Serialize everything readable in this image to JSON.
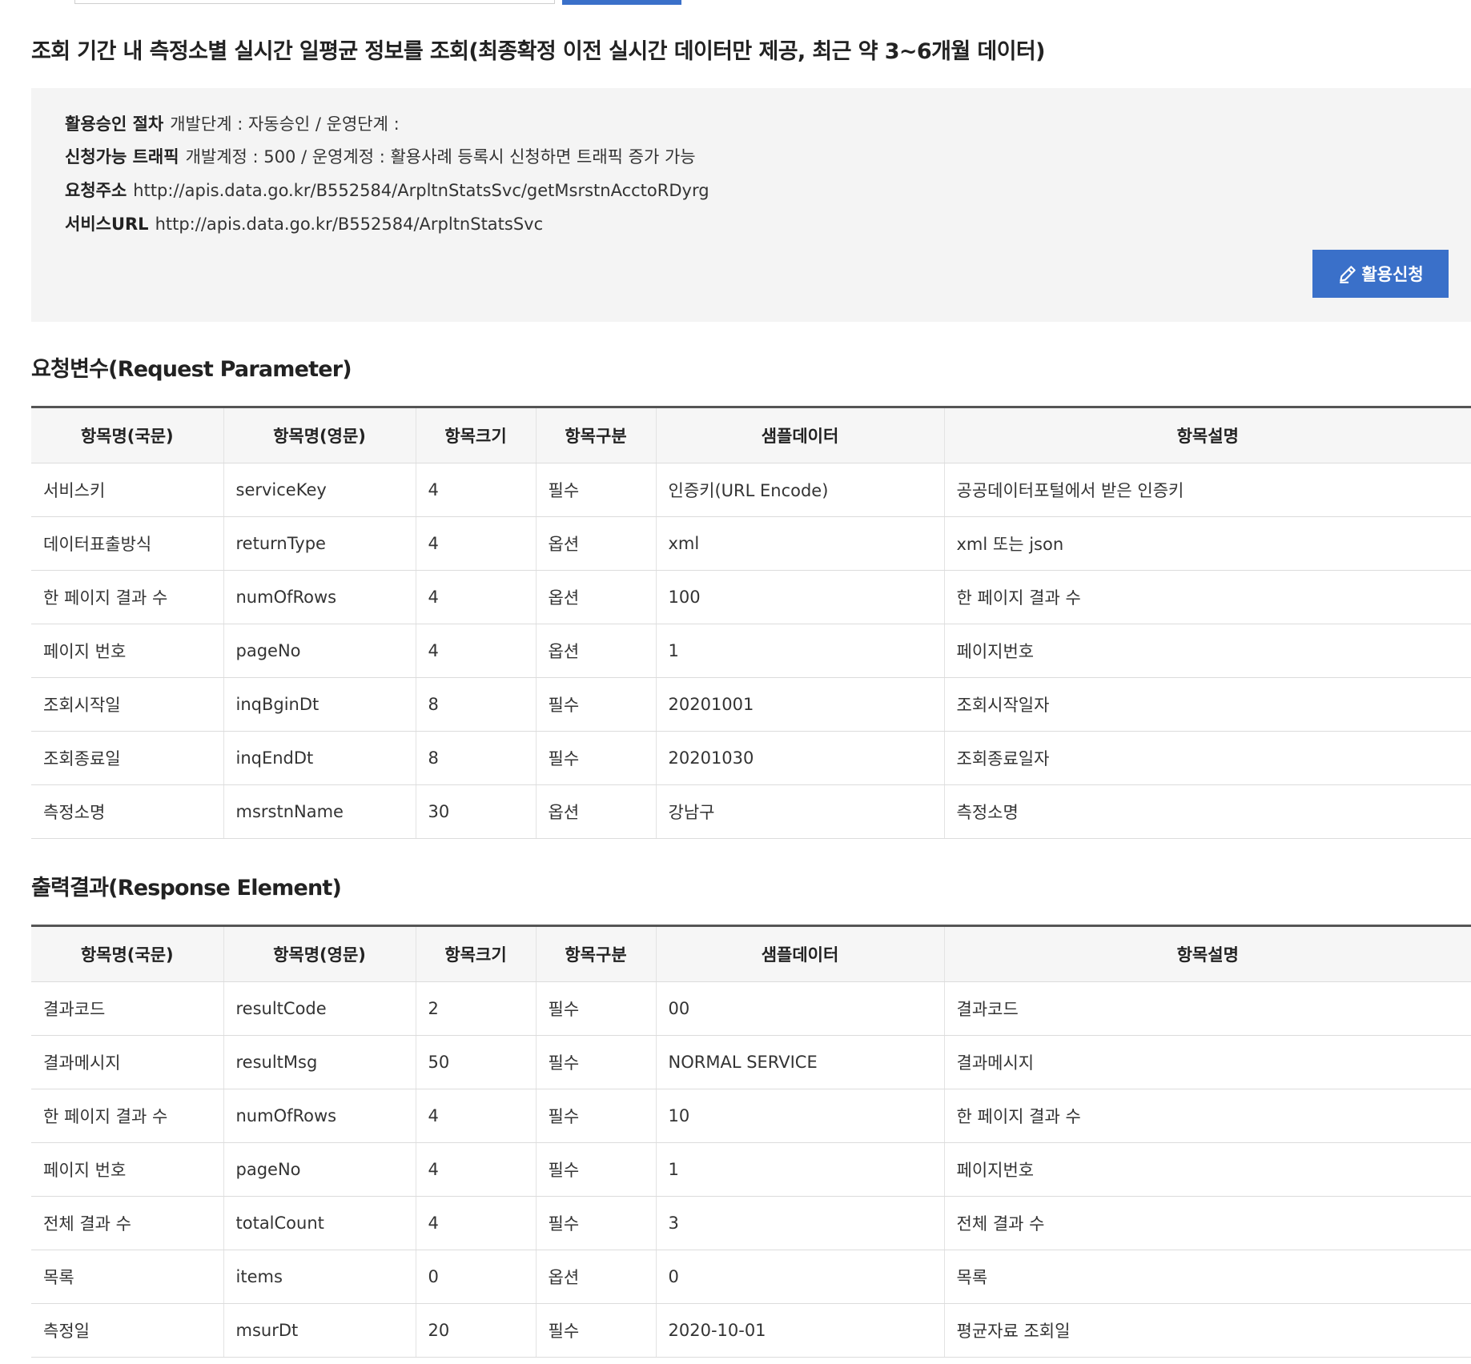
{
  "title": "조회 기간 내 측정소별 실시간 일평균 정보를 조회(최종확정 이전 실시간 데이터만 제공, 최근 약 3~6개월 데이터)",
  "info": {
    "approval": {
      "label": "활용승인 절차",
      "value": "개발단계 : 자동승인 / 운영단계 :"
    },
    "traffic": {
      "label": "신청가능 트래픽",
      "value": "개발계정 : 500 / 운영계정 : 활용사례 등록시 신청하면 트래픽 증가 가능"
    },
    "request_url": {
      "label": "요청주소",
      "value": "http://apis.data.go.kr/B552584/ArpltnStatsSvc/getMsrstnAcctoRDyrg"
    },
    "service_url": {
      "label": "서비스URL",
      "value": "http://apis.data.go.kr/B552584/ArpltnStatsSvc"
    },
    "apply_button": "활용신청",
    "apply_icon": "pencil-icon"
  },
  "accent_color": "#3a70c9",
  "request": {
    "title": "요청변수(Request Parameter)",
    "headers": [
      "항목명(국문)",
      "항목명(영문)",
      "항목크기",
      "항목구분",
      "샘플데이터",
      "항목설명"
    ],
    "rows": [
      [
        "서비스키",
        "serviceKey",
        "4",
        "필수",
        "인증키(URL Encode)",
        "공공데이터포털에서 받은 인증키"
      ],
      [
        "데이터표출방식",
        "returnType",
        "4",
        "옵션",
        "xml",
        "xml 또는 json"
      ],
      [
        "한 페이지 결과 수",
        "numOfRows",
        "4",
        "옵션",
        "100",
        "한 페이지 결과 수"
      ],
      [
        "페이지 번호",
        "pageNo",
        "4",
        "옵션",
        "1",
        "페이지번호"
      ],
      [
        "조회시작일",
        "inqBginDt",
        "8",
        "필수",
        "20201001",
        "조회시작일자"
      ],
      [
        "조회종료일",
        "inqEndDt",
        "8",
        "필수",
        "20201030",
        "조회종료일자"
      ],
      [
        "측정소명",
        "msrstnName",
        "30",
        "옵션",
        "강남구",
        "측정소명"
      ]
    ]
  },
  "response": {
    "title": "출력결과(Response Element)",
    "headers": [
      "항목명(국문)",
      "항목명(영문)",
      "항목크기",
      "항목구분",
      "샘플데이터",
      "항목설명"
    ],
    "rows": [
      [
        "결과코드",
        "resultCode",
        "2",
        "필수",
        "00",
        "결과코드"
      ],
      [
        "결과메시지",
        "resultMsg",
        "50",
        "필수",
        "NORMAL SERVICE",
        "결과메시지"
      ],
      [
        "한 페이지 결과 수",
        "numOfRows",
        "4",
        "필수",
        "10",
        "한 페이지 결과 수"
      ],
      [
        "페이지 번호",
        "pageNo",
        "4",
        "필수",
        "1",
        "페이지번호"
      ],
      [
        "전체 결과 수",
        "totalCount",
        "4",
        "필수",
        "3",
        "전체 결과 수"
      ],
      [
        "목록",
        "items",
        "0",
        "옵션",
        "0",
        "목록"
      ],
      [
        "측정일",
        "msurDt",
        "20",
        "필수",
        "2020-10-01",
        "평균자료 조회일"
      ]
    ]
  }
}
